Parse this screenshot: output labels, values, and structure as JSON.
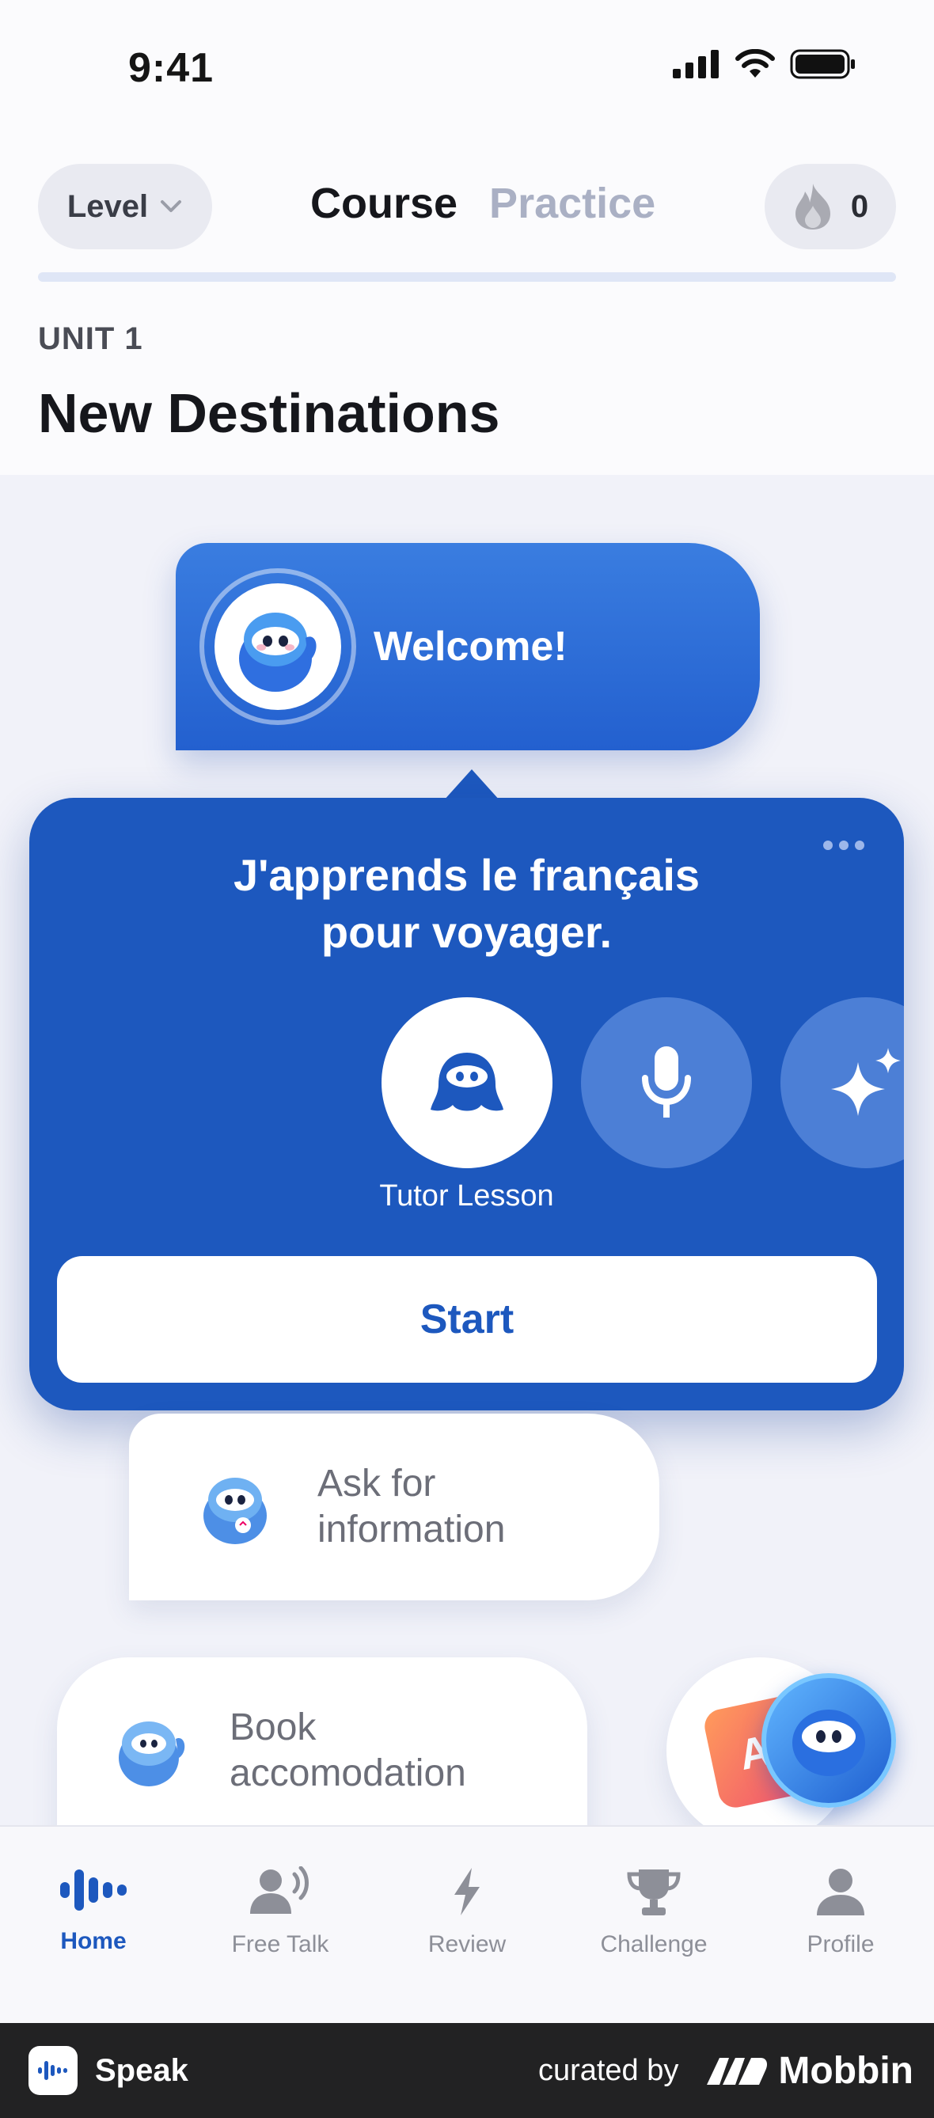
{
  "status_bar": {
    "time": "9:41"
  },
  "header": {
    "level_label": "Level",
    "tabs": [
      {
        "label": "Course"
      },
      {
        "label": "Practice"
      }
    ],
    "streak_count": "0"
  },
  "unit": {
    "label": "UNIT 1",
    "title": "New Destinations"
  },
  "welcome": {
    "label": "Welcome!"
  },
  "popover": {
    "title_line1": "J'apprends le français",
    "title_line2": "pour voyager.",
    "mode_label": "Tutor Lesson",
    "start_label": "Start"
  },
  "lessons": [
    {
      "line1": "Ask for",
      "line2": "information"
    },
    {
      "line1": "Book",
      "line2": "accomodation"
    }
  ],
  "ai_card_text": "AI",
  "nav": {
    "items": [
      {
        "label": "Home",
        "icon": "home-waveform-icon",
        "active": true
      },
      {
        "label": "Free Talk",
        "icon": "free-talk-icon",
        "active": false
      },
      {
        "label": "Review",
        "icon": "bolt-icon",
        "active": false
      },
      {
        "label": "Challenge",
        "icon": "trophy-icon",
        "active": false
      },
      {
        "label": "Profile",
        "icon": "person-icon",
        "active": false
      }
    ]
  },
  "footer": {
    "app_name": "Speak",
    "curated_by": "curated by",
    "brand": "Mobbin"
  },
  "colors": {
    "accent": "#1d58be",
    "inactive_tab": "#aab0c4",
    "nav_inactive": "#8d8f98"
  }
}
